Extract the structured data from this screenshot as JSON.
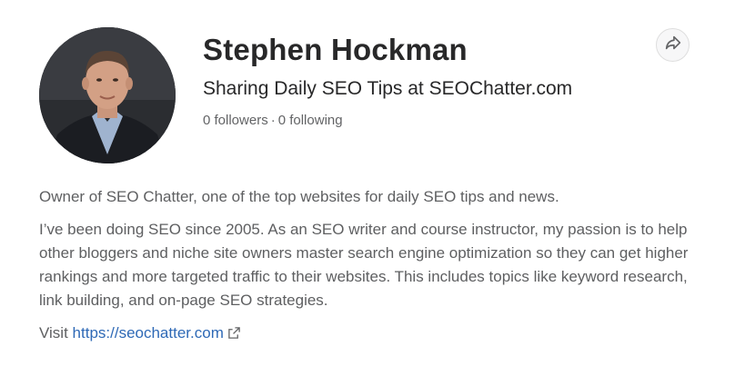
{
  "profile": {
    "name": "Stephen Hockman",
    "tagline": "Sharing Daily SEO Tips at SEOChatter.com",
    "followers": "0 followers",
    "separator": "·",
    "following": "0 following"
  },
  "bio": {
    "paragraph1": "Owner of SEO Chatter, one of the top websites for daily SEO tips and news.",
    "paragraph2": "I’ve been doing SEO since 2005. As an SEO writer and course instructor, my passion is to help other bloggers and niche site owners master search engine optimization so they can get higher rankings and more targeted traffic to their websites. This includes topics like keyword research, link building, and on-page SEO strategies.",
    "visit_prefix": "Visit",
    "link_text": "https://seochatter.com",
    "link_href": "https://seochatter.com"
  },
  "icons": {
    "share": "share-arrow-icon",
    "external_link": "external-link-icon"
  },
  "colors": {
    "link": "#2e69b6",
    "muted_text": "#636466",
    "heading_text": "#282829"
  }
}
